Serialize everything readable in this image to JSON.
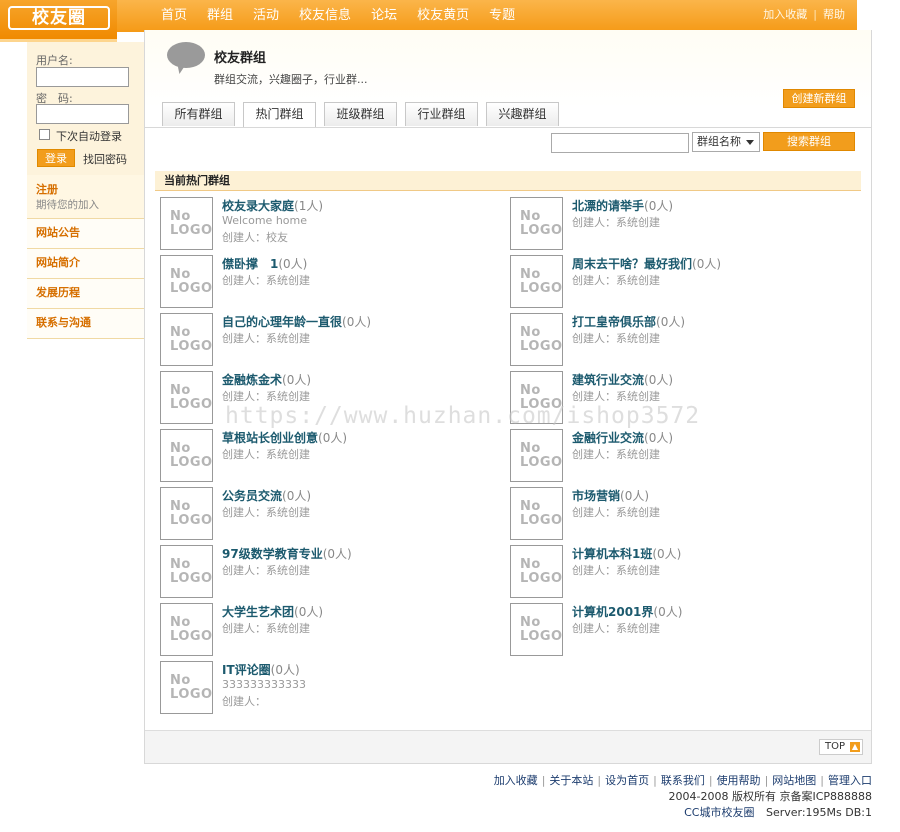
{
  "header": {
    "logo_text": "校友圈",
    "nav": [
      "首页",
      "群组",
      "活动",
      "校友信息",
      "论坛",
      "校友黄页",
      "专题"
    ],
    "links": [
      "加入收藏",
      "帮助"
    ]
  },
  "login": {
    "username_label": "用户名:",
    "password_label": "密　码:",
    "remember_label": "下次自动登录",
    "login_button": "登录",
    "forgot_link": "找回密码"
  },
  "sidebar": {
    "register": {
      "title": "注册",
      "subtitle": "期待您的加入"
    },
    "items": [
      "网站公告",
      "网站简介",
      "发展历程",
      "联系与沟通"
    ]
  },
  "page": {
    "title": "校友群组",
    "subtitle": "群组交流，兴趣圈子，行业群...",
    "create_button": "创建新群组"
  },
  "tabs": [
    "所有群组",
    "热门群组",
    "班级群组",
    "行业群组",
    "兴趣群组"
  ],
  "active_tab": 1,
  "search": {
    "input_value": "",
    "select_value": "群组名称",
    "button": "搜索群组"
  },
  "section_title": "当前热门群组",
  "nologo": {
    "line1": "No",
    "line2": "LOGO"
  },
  "groups": [
    {
      "name": "校友录大家庭",
      "count": "(1人)",
      "desc": "Welcome home",
      "creator": "创建人：校友"
    },
    {
      "name": "北漂的请举手",
      "count": "(0人)",
      "desc": "",
      "creator": "创建人：系统创建"
    },
    {
      "name": "僸卧撑　1",
      "count": "(0人)",
      "desc": "",
      "creator": "创建人：系统创建"
    },
    {
      "name": "周末去干啥？最好我们",
      "count": "(0人)",
      "desc": "",
      "creator": "创建人：系统创建"
    },
    {
      "name": "自己的心理年龄一直很",
      "count": "(0人)",
      "desc": "",
      "creator": "创建人：系统创建"
    },
    {
      "name": "打工皇帝俱乐部",
      "count": "(0人)",
      "desc": "",
      "creator": "创建人：系统创建"
    },
    {
      "name": "金融炼金术",
      "count": "(0人)",
      "desc": "",
      "creator": "创建人：系统创建"
    },
    {
      "name": "建筑行业交流",
      "count": "(0人)",
      "desc": "",
      "creator": "创建人：系统创建"
    },
    {
      "name": "草根站长创业创意",
      "count": "(0人)",
      "desc": "",
      "creator": "创建人：系统创建"
    },
    {
      "name": "金融行业交流",
      "count": "(0人)",
      "desc": "",
      "creator": "创建人：系统创建"
    },
    {
      "name": "公务员交流",
      "count": "(0人)",
      "desc": "",
      "creator": "创建人：系统创建"
    },
    {
      "name": "市场营销",
      "count": "(0人)",
      "desc": "",
      "creator": "创建人：系统创建"
    },
    {
      "name": "97级数学教育专业",
      "count": "(0人)",
      "desc": "",
      "creator": "创建人：系统创建"
    },
    {
      "name": "计算机本科1班",
      "count": "(0人)",
      "desc": "",
      "creator": "创建人：系统创建"
    },
    {
      "name": "大学生艺术团",
      "count": "(0人)",
      "desc": "",
      "creator": "创建人：系统创建"
    },
    {
      "name": "计算机2001界",
      "count": "(0人)",
      "desc": "",
      "creator": "创建人：系统创建"
    },
    {
      "name": "IT评论圈",
      "count": "(0人)",
      "desc": "333333333333",
      "creator": "创建人："
    }
  ],
  "top_button": "TOP",
  "watermark": "https://www.huzhan.com/ishop3572",
  "footer": {
    "links": [
      "加入收藏",
      "关于本站",
      "设为首页",
      "联系我们",
      "使用帮助",
      "网站地图",
      "管理入口"
    ],
    "copyright": "2004-2008 版权所有 京备案ICP888888",
    "site_name": "CC城市校友圈",
    "server_info": "Server:195Ms  DB:1"
  },
  "colors": {
    "accent": "#f29d1c",
    "link": "#1c5a6e",
    "sidebar_title": "#d66f00"
  }
}
